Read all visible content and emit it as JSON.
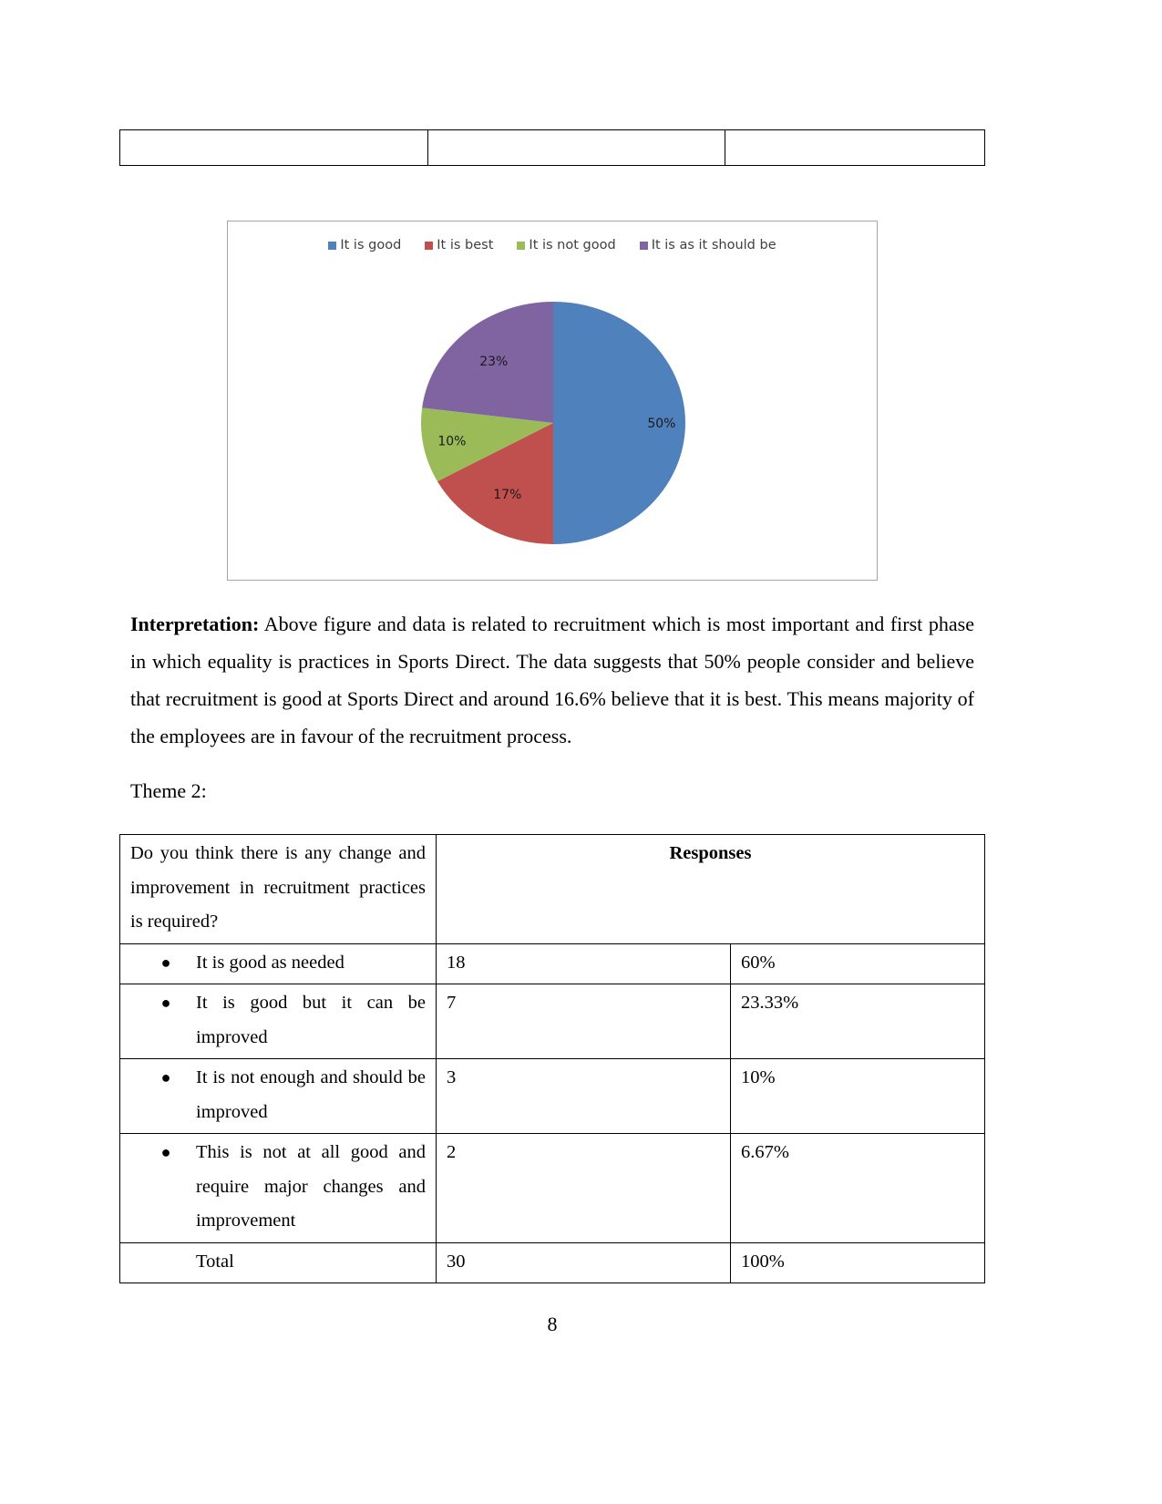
{
  "top_table": {
    "cells": [
      "",
      "",
      ""
    ]
  },
  "chart_data": {
    "type": "pie",
    "title": "",
    "legend_position": "top",
    "categories": [
      "It is good",
      "It is best",
      "It is not good",
      "It is as it should be"
    ],
    "values": [
      50,
      17,
      10,
      23
    ],
    "labels": [
      "50%",
      "17%",
      "10%",
      "23%"
    ],
    "colors": [
      "#4F81BD",
      "#C0504D",
      "#9BBB59",
      "#8064A2"
    ]
  },
  "interpretation": {
    "label": "Interpretation:",
    "text": " Above figure and data is related to recruitment which is most important and first phase in which equality is practices in Sports Direct. The data suggests that 50% people consider and believe that recruitment is good at Sports Direct and around 16.6% believe that it is best. This means majority of the employees are in favour of the recruitment process."
  },
  "theme_heading": "Theme 2:",
  "responses_table": {
    "question": "Do you think there is any change and improvement in recruitment practices is required?",
    "header": "Responses",
    "rows": [
      {
        "option": "It is good as needed",
        "count": "18",
        "percent": "60%"
      },
      {
        "option": "It is good but it can be improved",
        "count": "7",
        "percent": "23.33%"
      },
      {
        "option": "It is not enough and should be improved",
        "count": "3",
        "percent": "10%"
      },
      {
        "option": "This is not at all good and require major changes and improvement",
        "count": "2",
        "percent": "6.67%"
      }
    ],
    "total": {
      "label": "Total",
      "count": "30",
      "percent": "100%"
    }
  },
  "page_number": "8"
}
